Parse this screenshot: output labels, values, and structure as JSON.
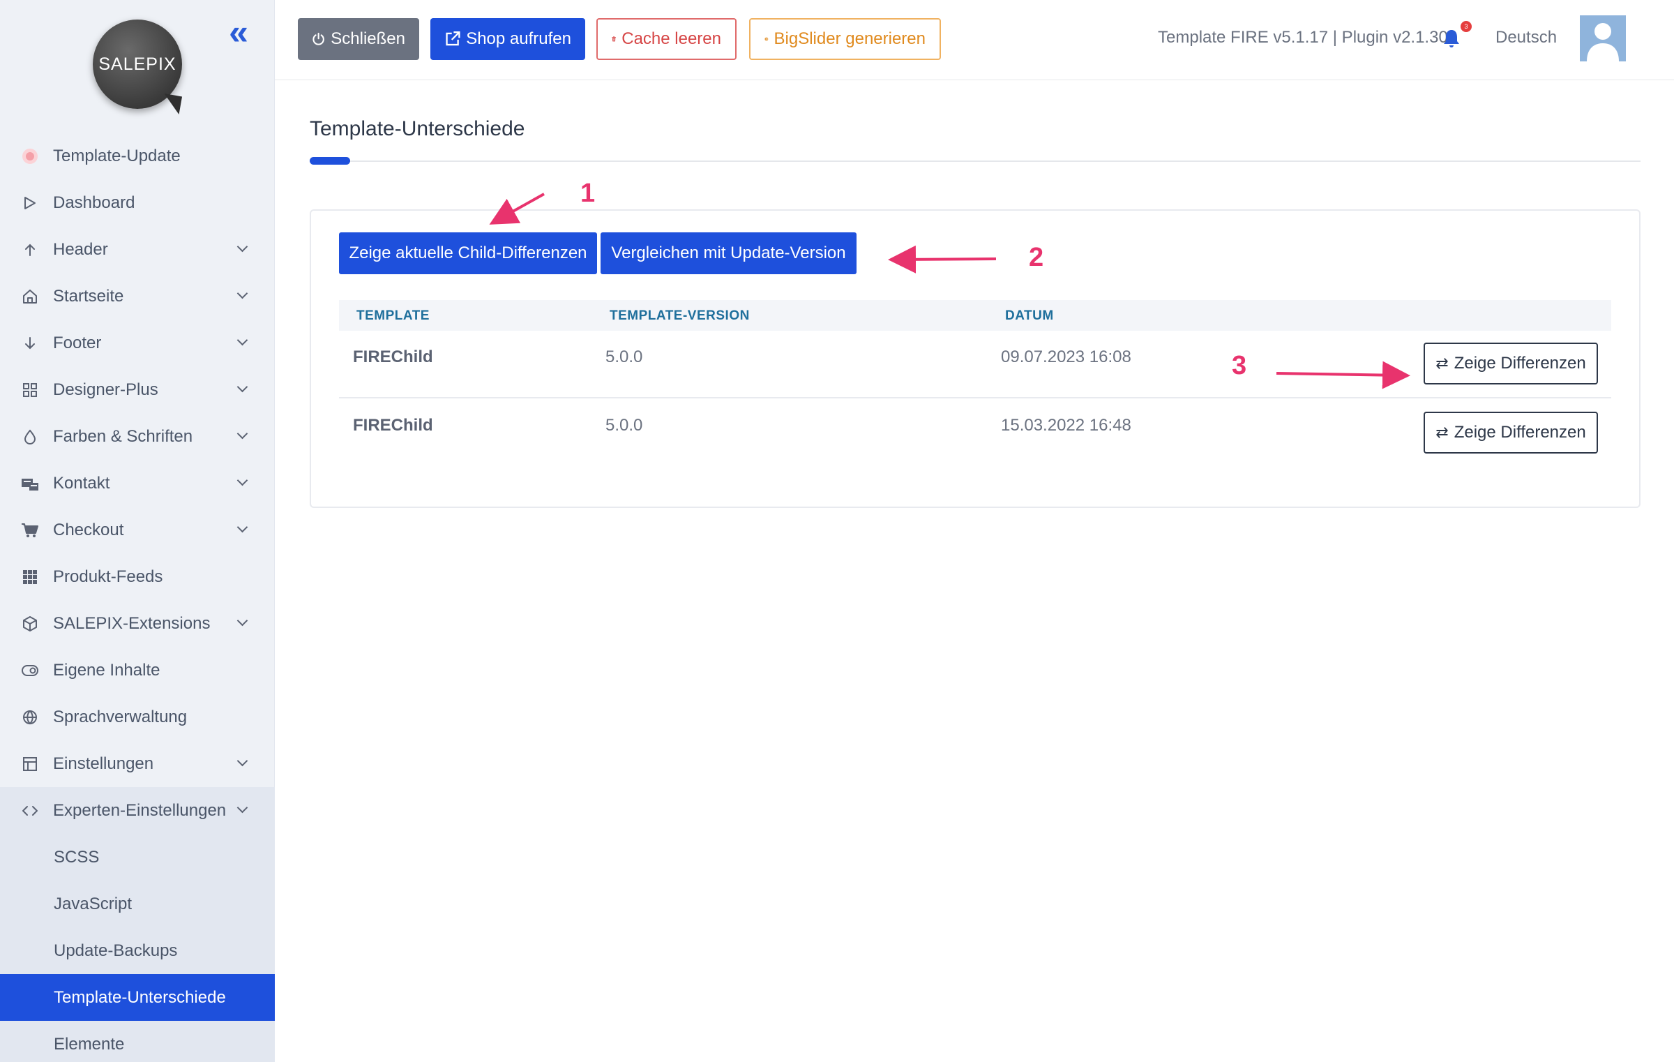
{
  "sidebar": {
    "logo_text": "SALEPIX",
    "collapse_icon": "«",
    "items": [
      {
        "label": "Template-Update",
        "icon": "dot-icon"
      },
      {
        "label": "Dashboard",
        "icon": "play-icon"
      },
      {
        "label": "Header",
        "icon": "arrow-up-icon"
      },
      {
        "label": "Startseite",
        "icon": "home-icon"
      },
      {
        "label": "Footer",
        "icon": "arrow-down-icon"
      },
      {
        "label": "Designer-Plus",
        "icon": "grid-icon"
      },
      {
        "label": "Farben & Schriften",
        "icon": "droplet-icon"
      },
      {
        "label": "Kontakt",
        "icon": "contact-icon"
      },
      {
        "label": "Checkout",
        "icon": "cart-icon"
      },
      {
        "label": "Produkt-Feeds",
        "icon": "apps-icon"
      },
      {
        "label": "SALEPIX-Extensions",
        "icon": "box-icon"
      },
      {
        "label": "Eigene Inhalte",
        "icon": "toggle-icon"
      },
      {
        "label": "Sprachverwaltung",
        "icon": "globe-icon"
      },
      {
        "label": "Einstellungen",
        "icon": "layout-icon"
      },
      {
        "label": "Experten-Einstellungen",
        "icon": "code-icon"
      }
    ],
    "subitems": [
      {
        "label": "SCSS"
      },
      {
        "label": "JavaScript"
      },
      {
        "label": "Update-Backups"
      },
      {
        "label": "Template-Unterschiede"
      },
      {
        "label": "Elemente"
      }
    ]
  },
  "topbar": {
    "close_label": "Schließen",
    "shop_label": "Shop aufrufen",
    "cache_label": "Cache leeren",
    "slider_label": "BigSlider generieren",
    "version_text": "Template FIRE v5.1.17 | Plugin v2.1.30",
    "notification_count": "3",
    "language": "Deutsch"
  },
  "main": {
    "title": "Template-Unterschiede",
    "btn_child_diff": "Zeige aktuelle Child-Differenzen",
    "btn_compare": "Vergleichen mit Update-Version",
    "table": {
      "headers": [
        "TEMPLATE",
        "TEMPLATE-VERSION",
        "DATUM"
      ],
      "rows": [
        {
          "template": "FIREChild",
          "version": "5.0.0",
          "date": "09.07.2023 16:08",
          "action": "Zeige Differenzen"
        },
        {
          "template": "FIREChild",
          "version": "5.0.0",
          "date": "15.03.2022 16:48",
          "action": "Zeige Differenzen"
        }
      ]
    }
  },
  "annotations": [
    "1",
    "2",
    "3"
  ],
  "colors": {
    "accent": "#1e50dc",
    "annotation": "#e8336d",
    "danger": "#d64545",
    "warning": "#e08a1e"
  }
}
